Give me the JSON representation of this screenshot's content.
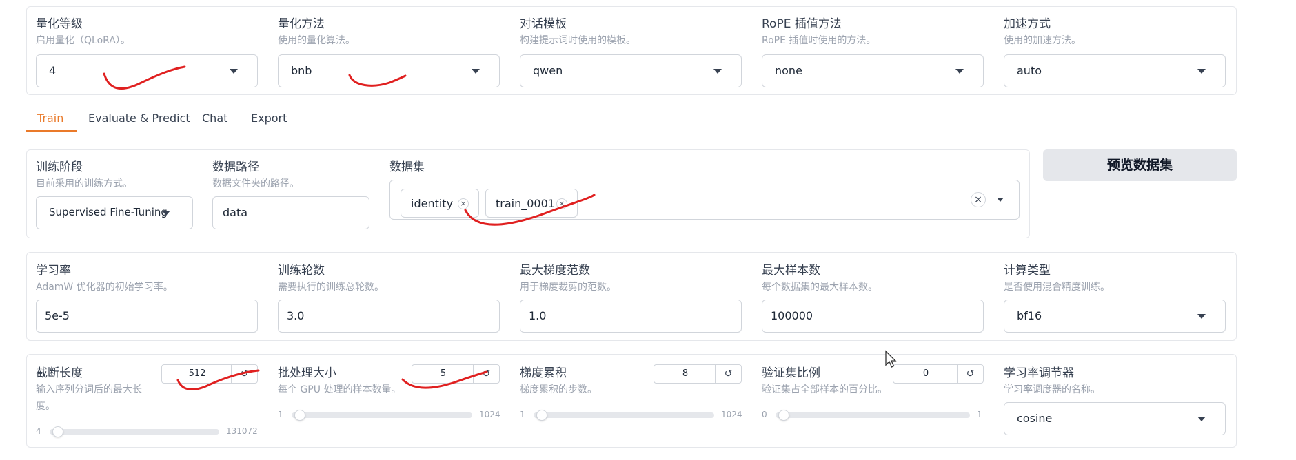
{
  "top_row": [
    {
      "label": "量化等级",
      "info": "启用量化（QLoRA）。",
      "value": "4"
    },
    {
      "label": "量化方法",
      "info": "使用的量化算法。",
      "value": "bnb"
    },
    {
      "label": "对话模板",
      "info": "构建提示词时使用的模板。",
      "value": "qwen"
    },
    {
      "label": "RoPE 插值方法",
      "info": "RoPE 插值时使用的方法。",
      "value": "none"
    },
    {
      "label": "加速方式",
      "info": "使用的加速方法。",
      "value": "auto"
    }
  ],
  "tabs": [
    "Train",
    "Evaluate & Predict",
    "Chat",
    "Export"
  ],
  "active_tab": "Train",
  "stage": {
    "label": "训练阶段",
    "info": "目前采用的训练方式。",
    "value": "Supervised Fine-Tuning"
  },
  "dataset_dir": {
    "label": "数据路径",
    "info": "数据文件夹的路径。",
    "value": "data"
  },
  "dataset": {
    "label": "数据集",
    "chips": [
      "identity",
      "train_0001"
    ],
    "clear_symbol": "×",
    "chip_close": "×"
  },
  "preview_button": "预览数据集",
  "params_row": [
    {
      "label": "学习率",
      "info": "AdamW 优化器的初始学习率。",
      "value": "5e-5"
    },
    {
      "label": "训练轮数",
      "info": "需要执行的训练总轮数。",
      "value": "3.0"
    },
    {
      "label": "最大梯度范数",
      "info": "用于梯度裁剪的范数。",
      "value": "1.0"
    },
    {
      "label": "最大样本数",
      "info": "每个数据集的最大样本数。",
      "value": "100000"
    },
    {
      "label": "计算类型",
      "info": "是否使用混合精度训练。",
      "value": "bf16"
    }
  ],
  "sliders": [
    {
      "label": "截断长度",
      "info_line1": "输入序列分词后的最大长",
      "info_line2": "度。",
      "value": "512",
      "min": "4",
      "max": "131072",
      "reset": "↺"
    },
    {
      "label": "批处理大小",
      "info": "每个 GPU 处理的样本数量。",
      "value": "5",
      "min": "1",
      "max": "1024",
      "reset": "↺"
    },
    {
      "label": "梯度累积",
      "info": "梯度累积的步数。",
      "value": "8",
      "min": "1",
      "max": "1024",
      "reset": "↺"
    },
    {
      "label": "验证集比例",
      "info": "验证集占全部样本的百分比。",
      "value": "0",
      "min": "0",
      "max": "1",
      "reset": "↺"
    }
  ],
  "scheduler": {
    "label": "学习率调节器",
    "info": "学习率调度器的名称。",
    "value": "cosine"
  },
  "colors": {
    "accent": "#ea7a2a",
    "annotation": "#e02020"
  }
}
